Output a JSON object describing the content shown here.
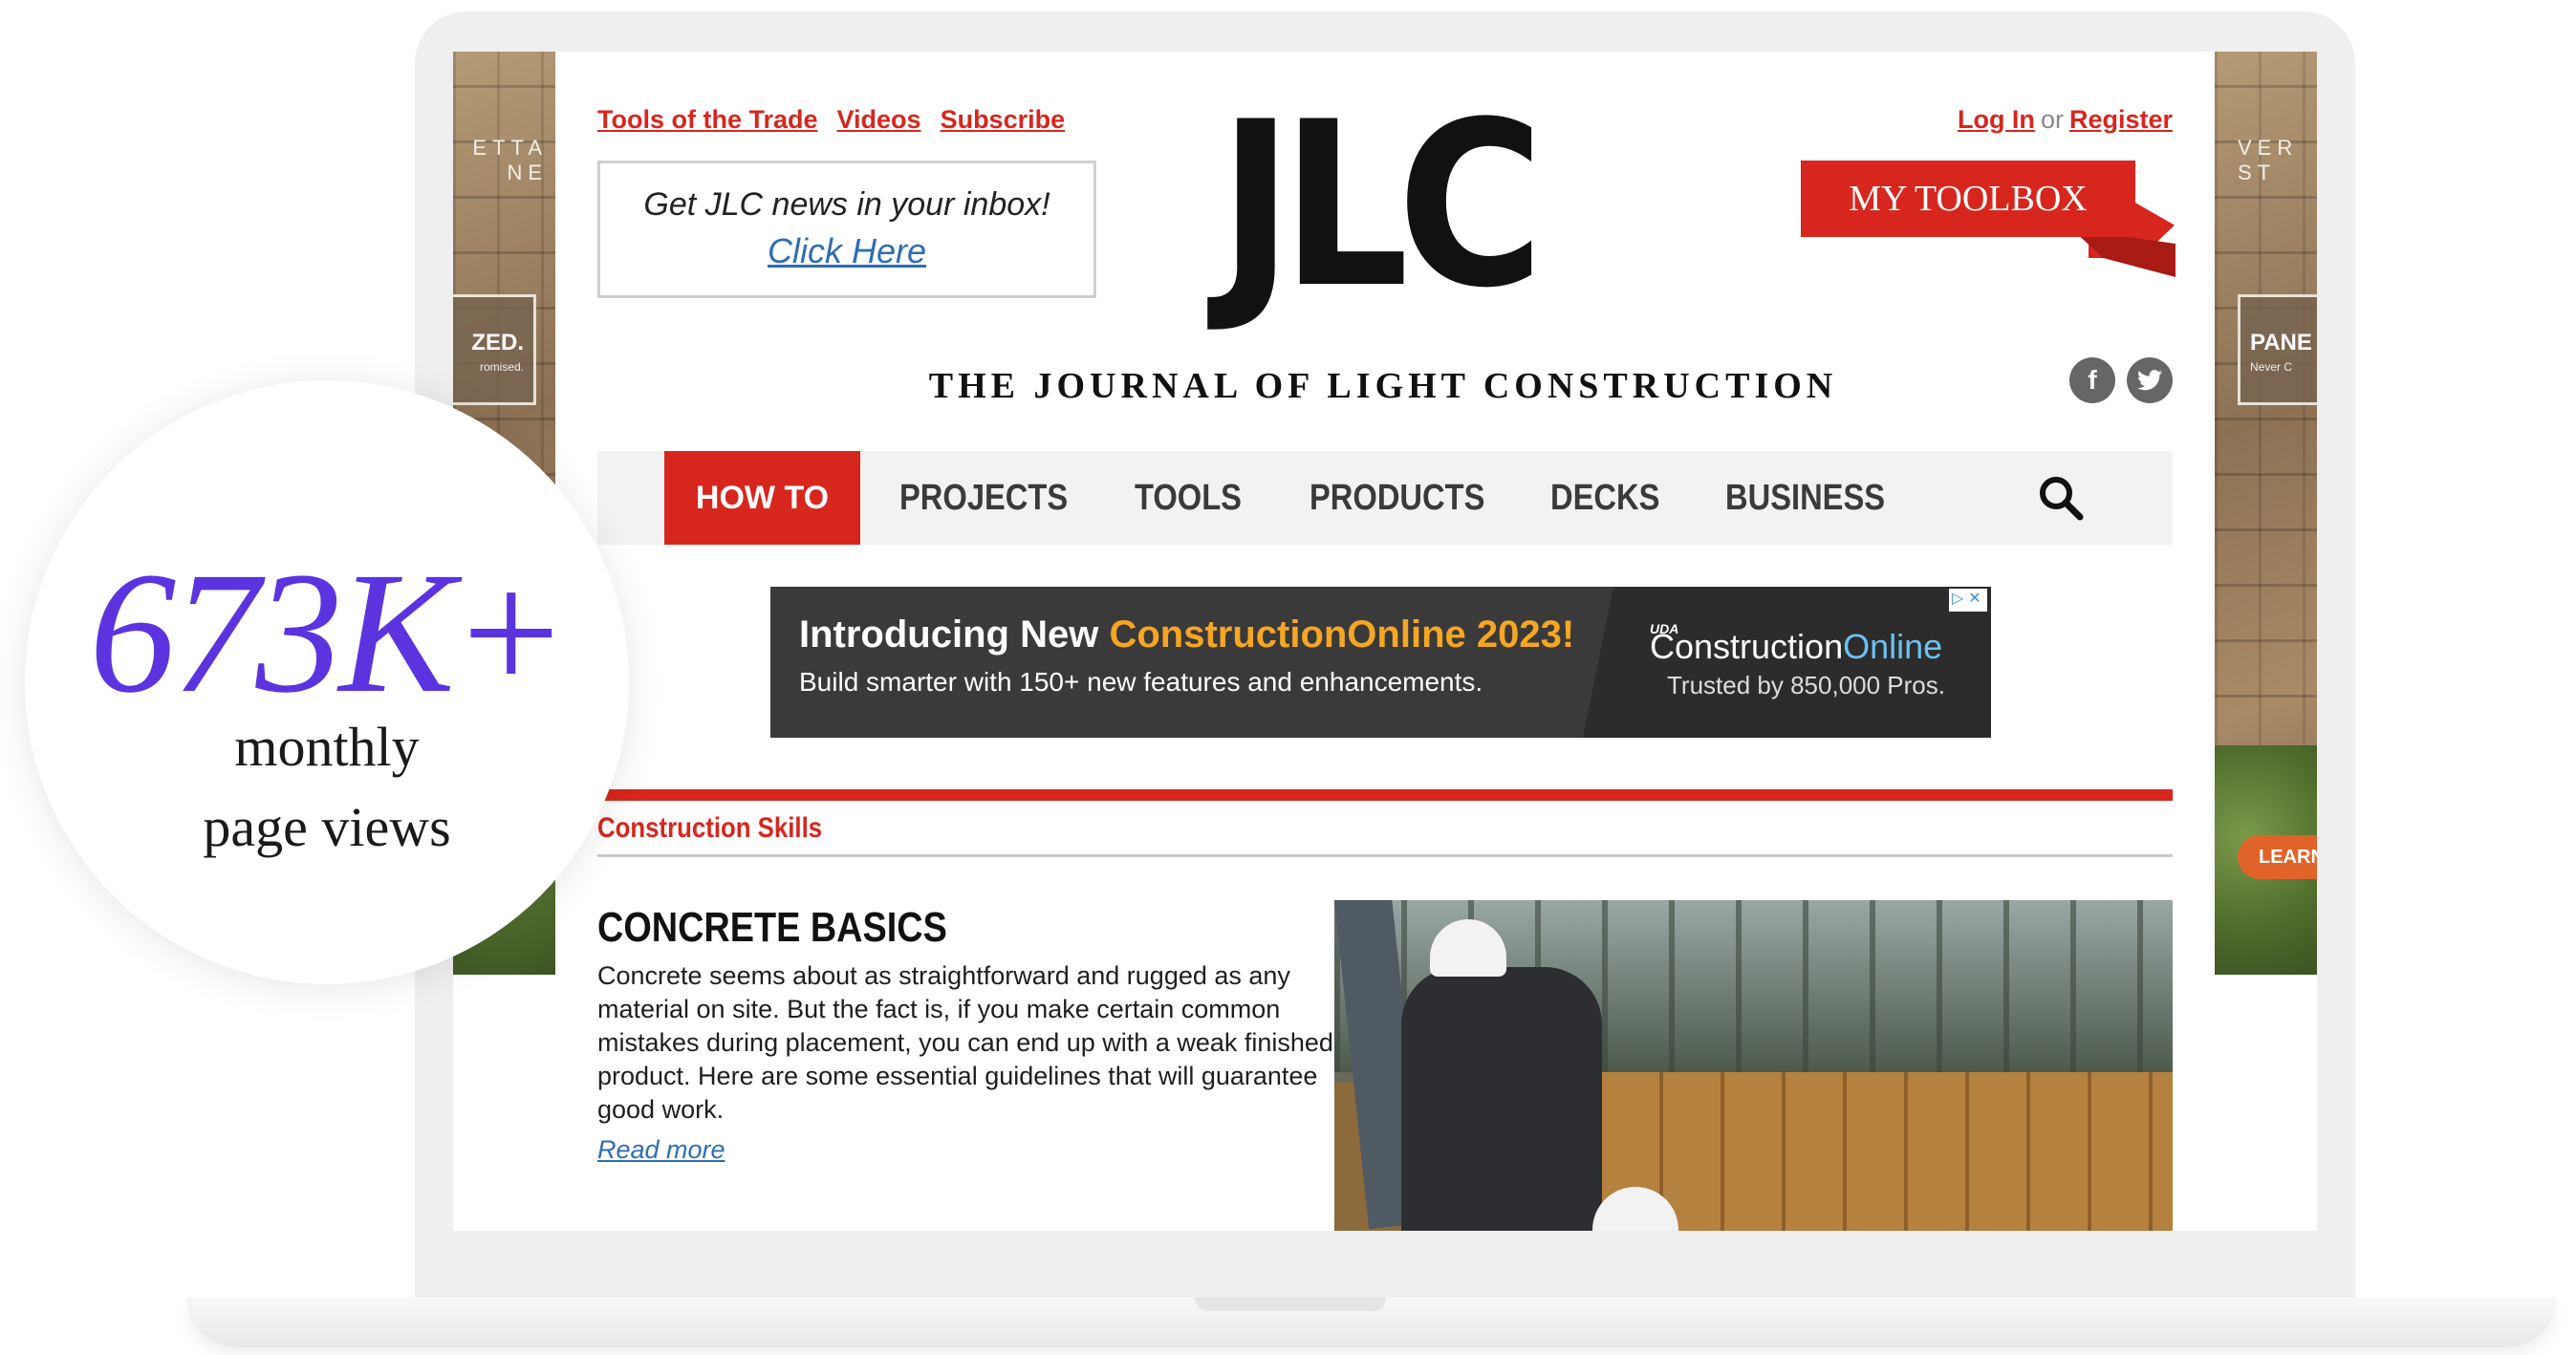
{
  "side_ads": {
    "left": {
      "brand": "ETTA\nNE",
      "tag_big": "ZED.",
      "tag_small": "romised."
    },
    "right": {
      "brand": "VER\nST",
      "tag_big": "PANE",
      "tag_small": "Never C",
      "cta": "LEARN"
    }
  },
  "header": {
    "top_links": [
      "Tools of the Trade",
      "Videos",
      "Subscribe"
    ],
    "newsletter": {
      "line1": "Get JLC news in your inbox!",
      "line2": "Click Here"
    },
    "logo": {
      "letters": "JLC",
      "tagline": "THE JOURNAL OF LIGHT CONSTRUCTION"
    },
    "login": {
      "log_in": "Log In",
      "or": "or",
      "register": "Register"
    },
    "toolbox_label": "MY TOOLBOX",
    "social": {
      "facebook": "f",
      "twitter": "t"
    }
  },
  "nav": {
    "items": [
      "HOW TO",
      "PROJECTS",
      "TOOLS",
      "PRODUCTS",
      "DECKS",
      "BUSINESS"
    ],
    "active": "HOW TO"
  },
  "banner_ad": {
    "headline_prefix": "Introducing New ",
    "headline_accent": "ConstructionOnline 2023!",
    "subline": "Build smarter with 150+ new features and enhancements.",
    "brand_top": "UDA",
    "brand_bold": "Construction",
    "brand_light": "Online",
    "trusted": "Trusted by 850,000 Pros."
  },
  "article": {
    "section": "Construction Skills",
    "title": "CONCRETE BASICS",
    "body": "Concrete seems about as straightforward and rugged as any material on site. But the fact is, if you make certain common mistakes during placement, you can end up with a weak finished product. Here are some essential guidelines that will guarantee good work.",
    "read_more": "Read more"
  },
  "stat": {
    "value": "673K+",
    "label_line1": "monthly",
    "label_line2": "page views"
  },
  "colors": {
    "brand_red": "#d7261e",
    "stat_purple": "#5b34e0",
    "link_blue": "#2f6db5",
    "banner_orange": "#f5a623"
  }
}
